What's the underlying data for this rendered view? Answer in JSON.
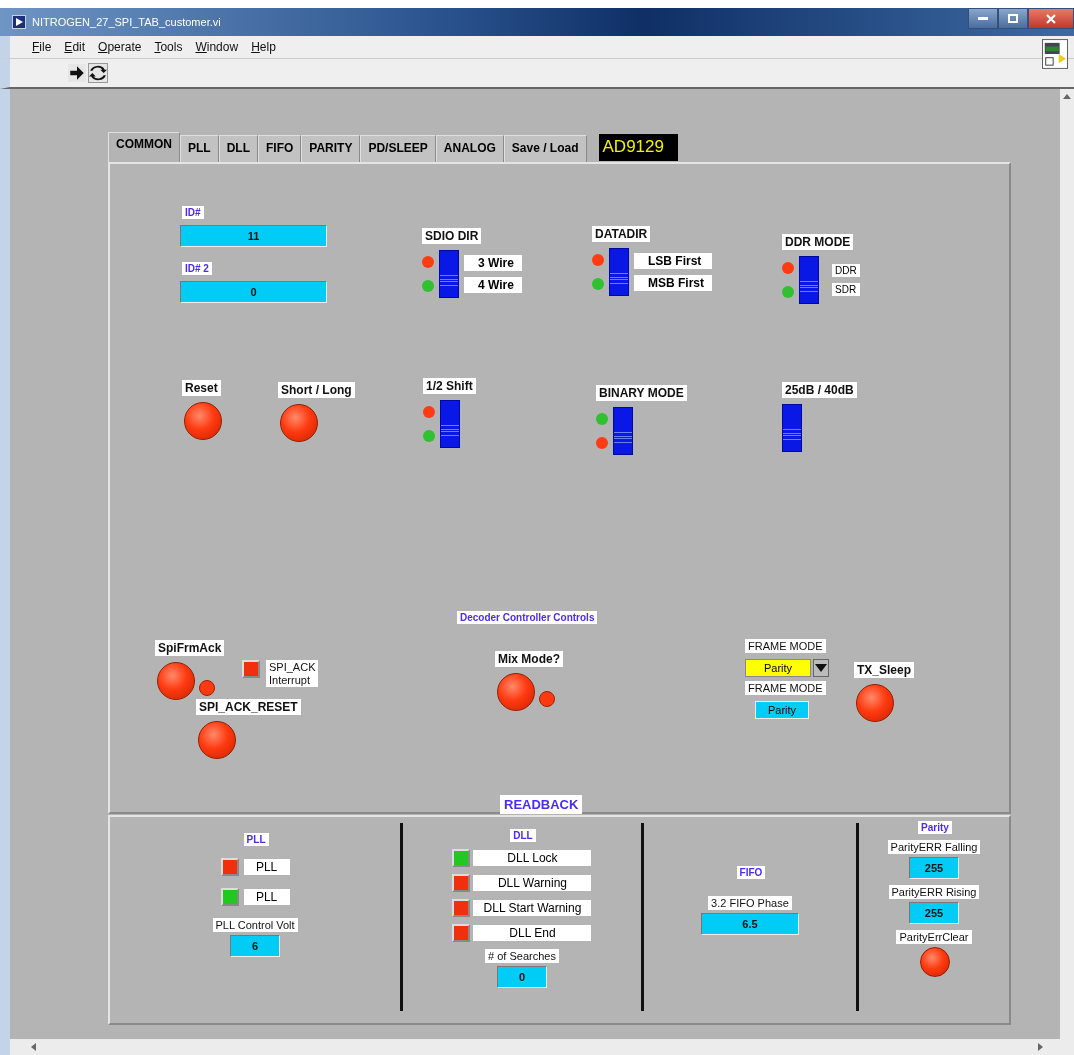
{
  "window": {
    "title": "NITROGEN_27_SPI_TAB_customer.vi"
  },
  "menu": [
    "File",
    "Edit",
    "Operate",
    "Tools",
    "Window",
    "Help"
  ],
  "tabs": [
    {
      "label": "COMMON",
      "selected": true
    },
    {
      "label": "PLL",
      "selected": false
    },
    {
      "label": "DLL",
      "selected": false
    },
    {
      "label": "FIFO",
      "selected": false
    },
    {
      "label": "PARITY",
      "selected": false
    },
    {
      "label": "PD/SLEEP",
      "selected": false
    },
    {
      "label": "ANALOG",
      "selected": false
    },
    {
      "label": "Save / Load",
      "selected": false
    }
  ],
  "device_label": "AD9129",
  "controls": [
    {
      "kind": "numeric",
      "label": "ID#",
      "value": "11"
    },
    {
      "kind": "numeric",
      "label": "ID# 2",
      "value": "0"
    },
    {
      "kind": "switch",
      "label": "SDIO DIR",
      "on": false,
      "options": [
        {
          "label": "3 Wire",
          "color": "#ff3b14"
        },
        {
          "label": "4 Wire",
          "color": "#2fc12f"
        }
      ]
    },
    {
      "kind": "switch",
      "label": "DATADIR",
      "on": false,
      "options": [
        {
          "label": "LSB First",
          "color": "#ff3b14"
        },
        {
          "label": "MSB First",
          "color": "#2fc12f"
        }
      ]
    },
    {
      "kind": "switch",
      "label": "DDR MODE",
      "on": false,
      "options": [
        {
          "label": "DDR",
          "color": "#ff3b14"
        },
        {
          "label": "SDR",
          "color": "#2fc12f"
        }
      ]
    },
    {
      "kind": "button",
      "label": "Reset"
    },
    {
      "kind": "button",
      "label": "Short / Long"
    },
    {
      "kind": "switch",
      "label": "1/2 Shift",
      "on": false,
      "options": [
        {
          "color": "#ff3b14"
        },
        {
          "color": "#2fc12f"
        }
      ]
    },
    {
      "kind": "switch",
      "label": "BINARY MODE",
      "on": false,
      "options": [
        {
          "color": "#2fc12f"
        },
        {
          "color": "#ff3b14"
        }
      ]
    },
    {
      "kind": "switch",
      "label": "25dB / 40dB",
      "on": false
    },
    {
      "kind": "header",
      "label": "Decoder Controller Controls"
    },
    {
      "kind": "button",
      "label": "SpiFrmAck",
      "led": true
    },
    {
      "kind": "square_led",
      "lines": [
        "SPI_ACK",
        "Interrupt"
      ],
      "on": false
    },
    {
      "kind": "button",
      "label": "SPI_ACK_RESET"
    },
    {
      "kind": "button",
      "label": "Mix Mode?",
      "led": true
    },
    {
      "kind": "ring",
      "label": "FRAME MODE",
      "value": "Parity"
    },
    {
      "kind": "indicator",
      "label": "FRAME MODE",
      "value": "Parity"
    },
    {
      "kind": "button",
      "label": "TX_Sleep"
    }
  ],
  "readback": {
    "title": "READBACK",
    "sections": [
      {
        "title": "PLL",
        "items": [
          {
            "kind": "led",
            "label": "PLL",
            "on": false
          },
          {
            "kind": "led",
            "label": "PLL",
            "on": true
          },
          {
            "kind": "numeric",
            "label": "PLL Control Volt",
            "value": "6"
          }
        ]
      },
      {
        "title": "DLL",
        "items": [
          {
            "kind": "led",
            "label": "DLL Lock",
            "on": true
          },
          {
            "kind": "led",
            "label": "DLL Warning",
            "on": false
          },
          {
            "kind": "led",
            "label": "DLL Start Warning",
            "on": false
          },
          {
            "kind": "led",
            "label": "DLL End",
            "on": false
          },
          {
            "kind": "numeric",
            "label": "# of Searches",
            "value": "0"
          }
        ]
      },
      {
        "title": "FIFO",
        "items": [
          {
            "kind": "numeric",
            "label": "3.2 FIFO Phase",
            "value": "6.5"
          }
        ]
      },
      {
        "title": "Parity",
        "items": [
          {
            "kind": "numeric",
            "label": "ParityERR Falling",
            "value": "255"
          },
          {
            "kind": "numeric",
            "label": "ParityERR Rising",
            "value": "255"
          },
          {
            "kind": "button",
            "label": "ParityErrClear"
          }
        ]
      }
    ]
  }
}
